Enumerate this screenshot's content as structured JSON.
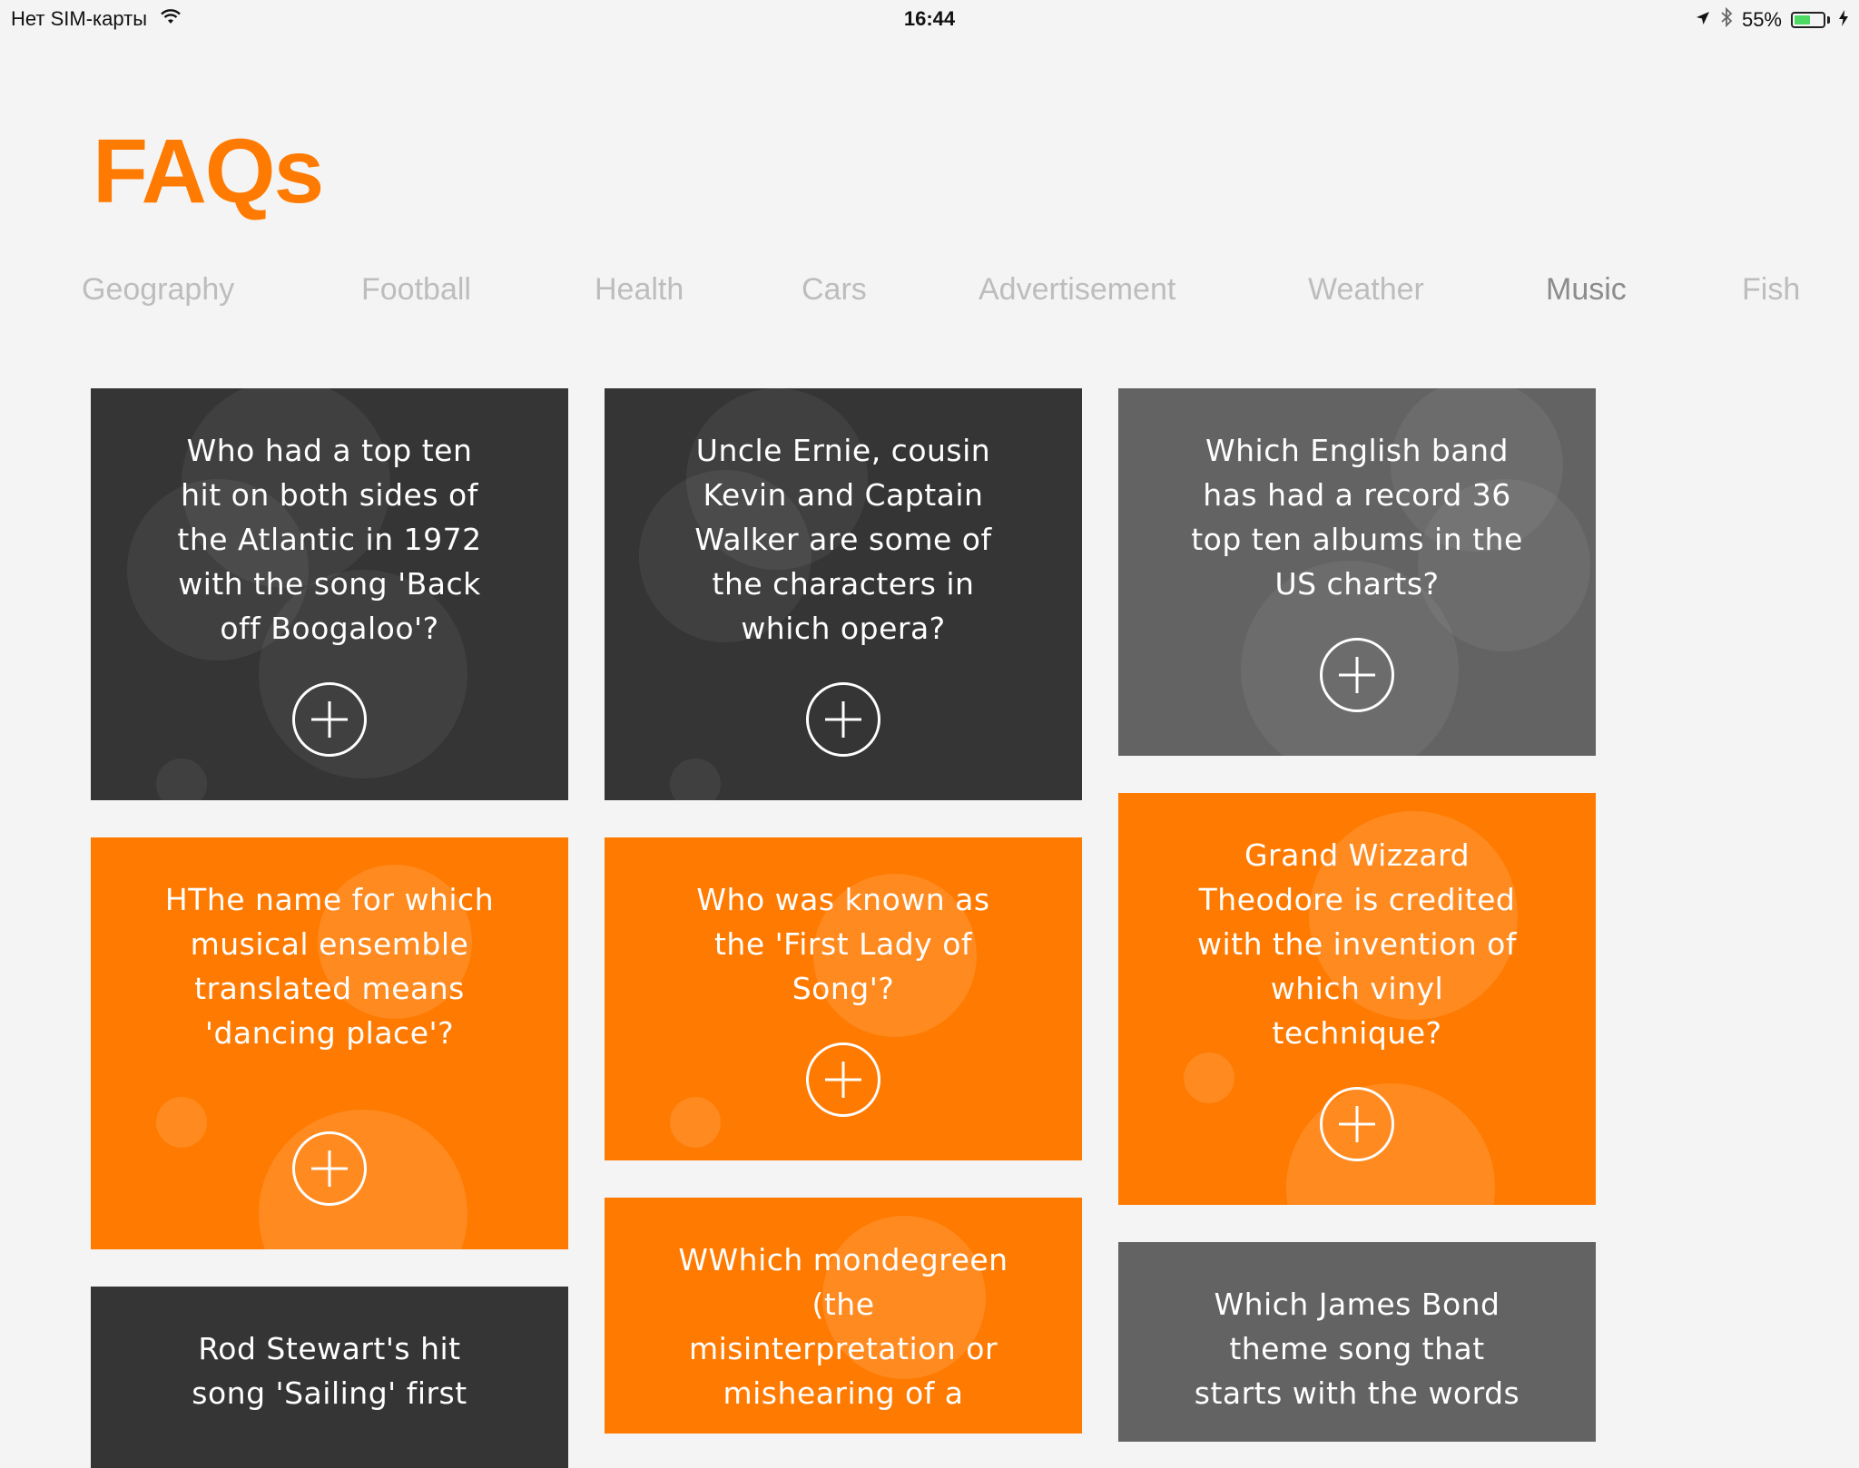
{
  "status_bar": {
    "carrier": "Нет SIM-карты",
    "time": "16:44",
    "battery_percent": "55%",
    "battery_level": 0.55,
    "icons": [
      "wifi-icon",
      "location-icon",
      "bluetooth-icon",
      "battery-icon",
      "charging-icon"
    ]
  },
  "page": {
    "title": "FAQs"
  },
  "tabs": [
    {
      "label": "Geography"
    },
    {
      "label": "Football"
    },
    {
      "label": "Health"
    },
    {
      "label": "Cars"
    },
    {
      "label": "Advertisement"
    },
    {
      "label": "Weather"
    },
    {
      "label": "Music",
      "active": true
    },
    {
      "label": "Fish"
    }
  ],
  "cards": [
    {
      "question": "Who had a top ten hit on both sides of the Atlantic in 1972 with the song 'Back off Boogaloo'?",
      "style": "dark"
    },
    {
      "question": "Uncle Ernie, cousin Kevin and Captain Walker are some of the characters in which opera?",
      "style": "dark"
    },
    {
      "question": "Which English band has had a record 36 top ten albums in the US charts?",
      "style": "grey"
    },
    {
      "question": "HThe name for which musical ensemble translated means 'dancing place'?",
      "style": "orange"
    },
    {
      "question": "Who was known as the 'First Lady of Song'?",
      "style": "orange"
    },
    {
      "question": "Grand Wizzard Theodore is credited with the invention of which vinyl technique?",
      "style": "orange"
    },
    {
      "question": "Rod Stewart's hit song 'Sailing' first",
      "style": "dark"
    },
    {
      "question": "WWhich mondegreen (the misinterpretation or mishearing of a",
      "style": "orange"
    },
    {
      "question": "Which James Bond theme song that starts with the words",
      "style": "grey"
    }
  ],
  "colors": {
    "accent": "#ff7a00",
    "dark_card": "#353535",
    "grey_card": "#636363",
    "background": "#f4f4f4"
  }
}
